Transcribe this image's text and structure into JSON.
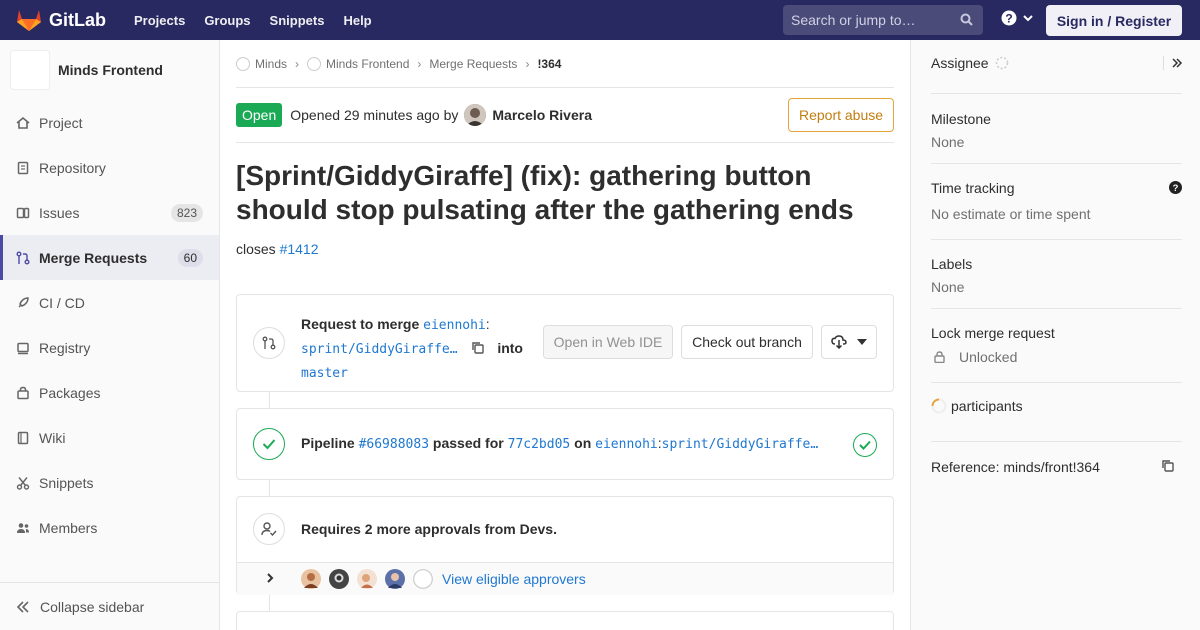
{
  "navbar": {
    "brand": "GitLab",
    "links": [
      "Projects",
      "Groups",
      "Snippets",
      "Help"
    ],
    "search_placeholder": "Search or jump to…",
    "signin": "Sign in / Register"
  },
  "sidebar": {
    "project_name": "Minds Frontend",
    "items": [
      {
        "label": "Project",
        "icon": "home-icon"
      },
      {
        "label": "Repository",
        "icon": "doc-icon"
      },
      {
        "label": "Issues",
        "icon": "issues-icon",
        "count": "823"
      },
      {
        "label": "Merge Requests",
        "icon": "merge-request-icon",
        "count": "60",
        "active": true
      },
      {
        "label": "CI / CD",
        "icon": "rocket-icon"
      },
      {
        "label": "Registry",
        "icon": "container-icon"
      },
      {
        "label": "Packages",
        "icon": "package-icon"
      },
      {
        "label": "Wiki",
        "icon": "book-icon"
      },
      {
        "label": "Snippets",
        "icon": "scissors-icon"
      },
      {
        "label": "Members",
        "icon": "users-icon"
      }
    ],
    "collapse": "Collapse sidebar"
  },
  "breadcrumb": [
    "Minds",
    "Minds Frontend",
    "Merge Requests",
    "!364"
  ],
  "mr": {
    "status": "Open",
    "opened_text": "Opened 29 minutes ago by",
    "author": "Marcelo Rivera",
    "report_abuse": "Report abuse",
    "title": "[Sprint/GiddyGiraffe] (fix): gathering button should stop pulsating after the gathering ends",
    "desc_prefix": "closes",
    "desc_link": "#1412"
  },
  "merge_widget": {
    "request_label": "Request to merge",
    "source_owner": "eiennohi",
    "colon": ":",
    "source_branch": "sprint/GiddyGiraffe…",
    "into": "into",
    "target": "master",
    "web_ide": "Open in Web IDE",
    "checkout": "Check out branch"
  },
  "pipeline": {
    "label": "Pipeline",
    "id": "#66988083",
    "passed_for": "passed for",
    "commit": "77c2bd05",
    "on": "on",
    "owner": "eiennohi",
    "colon": ":",
    "branch": "sprint/GiddyGiraffe…"
  },
  "approvals": {
    "text": "Requires 2 more approvals from Devs.",
    "view_link": "View eligible approvers"
  },
  "right_sidebar": {
    "assignee": "Assignee",
    "milestone": "Milestone",
    "milestone_value": "None",
    "time_tracking": "Time tracking",
    "time_value": "No estimate or time spent",
    "labels": "Labels",
    "labels_value": "None",
    "lock": "Lock merge request",
    "lock_value": "Unlocked",
    "participants": "participants",
    "reference": "Reference: minds/front!364"
  },
  "colors": {
    "navbar": "#292961",
    "open_badge": "#1aaa55",
    "link": "#1f78d1",
    "report_abuse": "#c17d10",
    "success": "#1aaa55"
  }
}
